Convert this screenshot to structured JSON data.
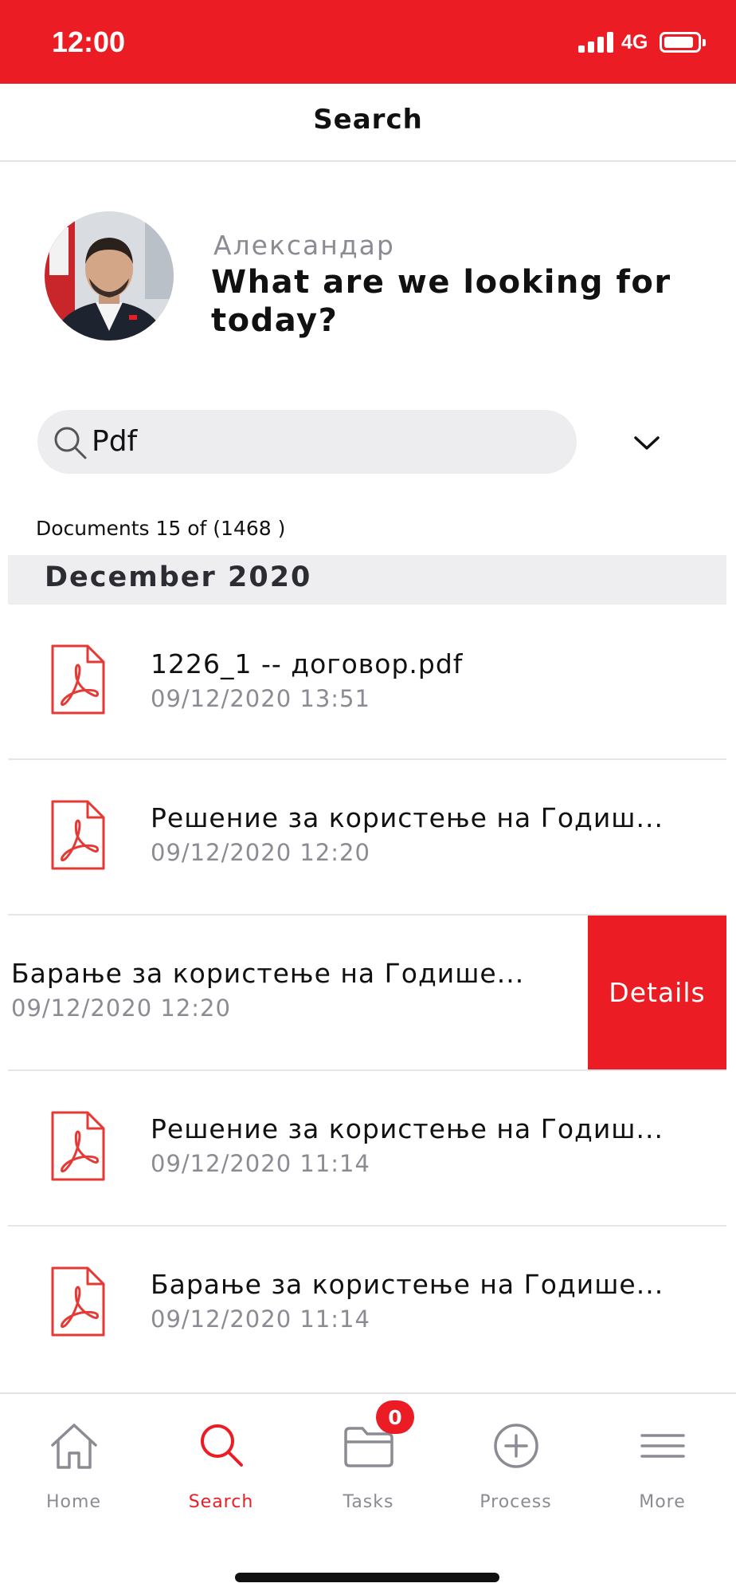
{
  "status_bar": {
    "time": "12:00",
    "network": "4G"
  },
  "header": {
    "title": "Search"
  },
  "greeting": {
    "name": "Александар",
    "question": "What are we looking for today?"
  },
  "search": {
    "value": "Pdf"
  },
  "results": {
    "count_text": "Documents 15 of (1468 )"
  },
  "section": {
    "label": "December 2020"
  },
  "documents": [
    {
      "title": "1226_1 -- договор.pdf",
      "date": "09/12/2020 13:51"
    },
    {
      "title": "Решение за користење на Годиш...",
      "date": "09/12/2020 12:20"
    },
    {
      "title": "Барање за користење на Годише...",
      "date": "09/12/2020 12:20",
      "action_label": "Details"
    },
    {
      "title": "Решение за користење на Годиш...",
      "date": "09/12/2020 11:14"
    },
    {
      "title": "Барање за користење на Годише...",
      "date": "09/12/2020 11:14"
    }
  ],
  "tabs": [
    {
      "label": "Home",
      "icon": "home-icon"
    },
    {
      "label": "Search",
      "icon": "search-icon",
      "active": true
    },
    {
      "label": "Tasks",
      "icon": "folder-icon",
      "badge": "0"
    },
    {
      "label": "Process",
      "icon": "plus-circle-icon"
    },
    {
      "label": "More",
      "icon": "menu-icon"
    }
  ],
  "colors": {
    "accent": "#ec1c24",
    "muted_text": "#8b8b94",
    "section_bg": "#eeeef1",
    "search_bg": "#ededf0"
  }
}
